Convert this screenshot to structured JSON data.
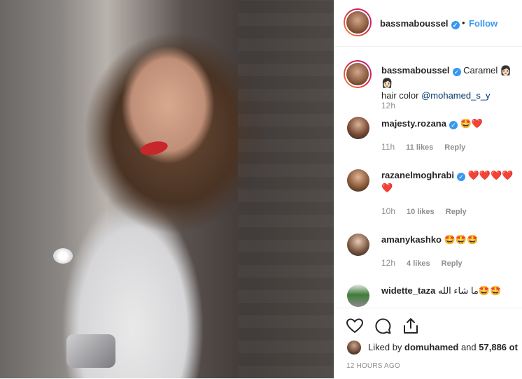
{
  "post": {
    "author": "bassmaboussel",
    "follow_label": "Follow",
    "separator": "•"
  },
  "caption": {
    "username": "bassmaboussel",
    "text": "Caramel",
    "emoji": "👩🏻 👩🏻",
    "line2_prefix": "hair color ",
    "mention": "@mohamed_s_y",
    "time": "12h"
  },
  "comments": [
    {
      "username": "majesty.rozana",
      "verified": true,
      "text": "🤩❤️",
      "time": "11h",
      "likes": "11 likes",
      "reply": "Reply"
    },
    {
      "username": "razanelmoghrabi",
      "verified": true,
      "text": "❤️❤️❤️❤️",
      "text2": "❤️",
      "time": "10h",
      "likes": "10 likes",
      "reply": "Reply"
    },
    {
      "username": "amanykashko",
      "verified": false,
      "text": "🤩🤩🤩",
      "time": "12h",
      "likes": "4 likes",
      "reply": "Reply"
    },
    {
      "username": "widette_taza",
      "verified": false,
      "text": "ما شاء الله🤩🤩"
    }
  ],
  "actions": {
    "liked_by_prefix": "Liked by ",
    "liked_by_user": "domuhamed",
    "liked_by_suffix": " and ",
    "liked_count": "57,886 ot",
    "timestamp": "12 HOURS AGO"
  },
  "colors": {
    "accent": "#3897f0",
    "heart": "#e0242b",
    "muted": "#8e8e8e"
  }
}
